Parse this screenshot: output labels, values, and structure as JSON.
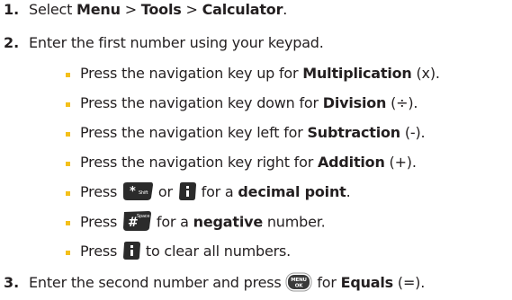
{
  "steps": [
    {
      "number": "1.",
      "parts": [
        "Select ",
        "Menu",
        " > ",
        "Tools",
        " > ",
        "Calculator",
        "."
      ]
    },
    {
      "number": "2.",
      "parts": [
        "Enter the first number using your keypad."
      ]
    },
    {
      "number": "3.",
      "parts": [
        "Enter the second number and press ",
        " for ",
        "Equals",
        " (=)."
      ]
    }
  ],
  "bullets": [
    {
      "parts": [
        "Press the navigation key up for ",
        "Multiplication",
        " (x)."
      ]
    },
    {
      "parts": [
        "Press the navigation key down for ",
        "Division",
        " (÷)."
      ]
    },
    {
      "parts": [
        "Press the navigation key left for ",
        "Subtraction",
        " (-)."
      ]
    },
    {
      "parts": [
        "Press the navigation key right for ",
        "Addition",
        " (+)."
      ]
    },
    {
      "parts": [
        "Press ",
        " or ",
        " for a ",
        "decimal point",
        "."
      ]
    },
    {
      "parts": [
        "Press ",
        " for a ",
        "negative",
        " number."
      ]
    },
    {
      "parts": [
        "Press ",
        " to clear all numbers."
      ]
    }
  ],
  "keys": {
    "star_key": {
      "glyph": "*",
      "sub": "Shift"
    },
    "back_key": {
      "glyph": "i"
    },
    "pound_key": {
      "glyph": "#",
      "sub": "Space"
    },
    "clear_key": {
      "glyph": "i"
    },
    "menu_ok_key": {
      "top": "MENU",
      "bottom": "OK"
    }
  },
  "colors": {
    "text": "#231f20",
    "bullet": "#f4c01a",
    "key_dark": "#2b2b2b"
  }
}
